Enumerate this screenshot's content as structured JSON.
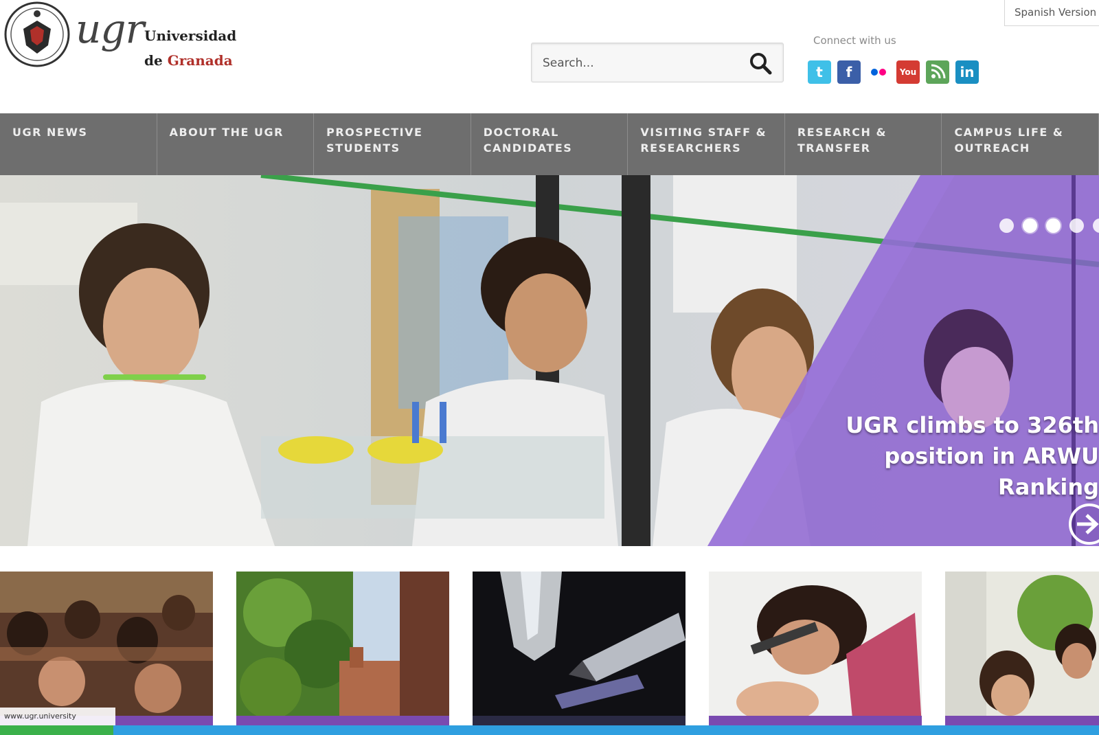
{
  "header": {
    "logo_mark": "ugr",
    "logo_line1": "Universidad",
    "logo_line2_prefix": "de",
    "logo_line2_city": "Granada",
    "search_placeholder": "Search...",
    "search_icon": "search-icon",
    "connect_label": "Connect with us",
    "language_selector": "Spanish Version",
    "social": [
      {
        "name": "twitter-icon",
        "glyph": "t",
        "color": "#3fc0e8"
      },
      {
        "name": "facebook-icon",
        "glyph": "f",
        "color": "#3b5fa8"
      },
      {
        "name": "flickr-icon",
        "glyph": "",
        "color": "#ffffff"
      },
      {
        "name": "youtube-icon",
        "glyph": "You",
        "color": "#d43b33"
      },
      {
        "name": "rss-icon",
        "glyph": "",
        "color": "#5da55a"
      },
      {
        "name": "linkedin-icon",
        "glyph": "in",
        "color": "#1a8fc2"
      }
    ]
  },
  "nav": {
    "items": [
      {
        "label": "UGR NEWS"
      },
      {
        "label": "ABOUT THE UGR"
      },
      {
        "label": "PROSPECTIVE STUDENTS"
      },
      {
        "label": "DOCTORAL CANDIDATES"
      },
      {
        "label": "VISITING STAFF & RESEARCHERS"
      },
      {
        "label": "RESEARCH & TRANSFER"
      },
      {
        "label": "CAMPUS LIFE & OUTREACH"
      }
    ]
  },
  "hero": {
    "caption_line1": "UGR climbs to 326th",
    "caption_line2": "position in ARWU",
    "caption_line3": "Ranking",
    "slide_count": 5,
    "active_slide": 2,
    "overlay_color": "#8a5fd0"
  },
  "thumbnails": {
    "first_label": "www.ugr.university"
  },
  "colors": {
    "nav_bg": "#6e6e6e",
    "accent_red": "#b0302a",
    "purple": "#8a5fd0"
  }
}
